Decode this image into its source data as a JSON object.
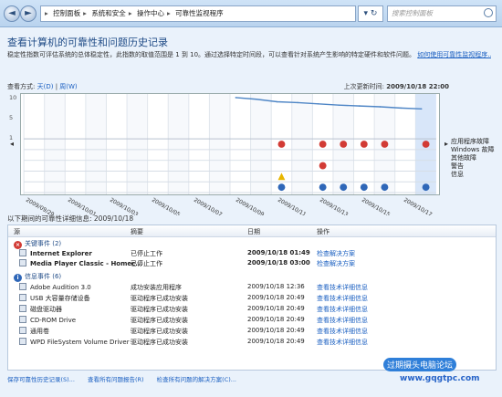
{
  "address": {
    "crumbs": [
      "控制面板",
      "系统和安全",
      "操作中心",
      "可靠性监视程序"
    ],
    "search_placeholder": "搜索控制面板"
  },
  "page": {
    "title": "查看计算机的可靠性和问题历史记录",
    "description": "稳定性指数可评估系统的总体稳定性，此指数的取值范围是 1 到 10。通过选择特定时间段，可以查看针对系统产生影响的特定硬件和软件问题。",
    "description_link": "如何使用可靠性监视程序..."
  },
  "view": {
    "label": "查看方式:",
    "day": "天(D)",
    "sep": "|",
    "week": "周(W)"
  },
  "last_updated": {
    "label": "上次更新时间:",
    "value": "2009/10/18 22:00"
  },
  "chart_data": {
    "type": "line",
    "x": [
      "2009/09/29",
      "2009/10/01",
      "2009/10/03",
      "2009/10/05",
      "2009/10/07",
      "2009/10/09",
      "2009/10/11",
      "2009/10/13",
      "2009/10/15",
      "2009/10/17"
    ],
    "y_ticks": [
      "10",
      "5",
      "1"
    ],
    "ylim": [
      1,
      10
    ],
    "series": [
      {
        "points": [
          [
            "2009/10/09",
            10
          ],
          [
            "2009/10/10",
            9.6
          ],
          [
            "2009/10/11",
            9.0
          ],
          [
            "2009/10/12",
            8.8
          ],
          [
            "2009/10/13",
            8.5
          ],
          [
            "2009/10/14",
            8.2
          ],
          [
            "2009/10/15",
            8.0
          ],
          [
            "2009/10/16",
            7.8
          ],
          [
            "2009/10/17",
            7.5
          ],
          [
            "2009/10/18",
            7.3
          ]
        ]
      }
    ],
    "row_labels": [
      "应用程序故障",
      "Windows 故障",
      "其他故障",
      "警告",
      "信息"
    ]
  },
  "details": {
    "label": "以下期间的可靠性详细信息: 2009/10/18",
    "columns": [
      "源",
      "摘要",
      "日期",
      "操作"
    ],
    "groups": [
      {
        "title": "关键事件 (2)",
        "rows": [
          {
            "source": "Internet Explorer",
            "summary": "已停止工作",
            "date": "2009/10/18 01:49",
            "action": "检查解决方案"
          },
          {
            "source": "Media Player Classic - Homec...",
            "summary": "已停止工作",
            "date": "2009/10/18 03:00",
            "action": "检查解决方案"
          }
        ]
      },
      {
        "title": "信息事件 (6)",
        "rows": [
          {
            "source": "Adobe Audition 3.0",
            "summary": "成功安装应用程序",
            "date": "2009/10/18 12:36",
            "action": "查看技术详细信息"
          },
          {
            "source": "USB 大容量存储设备",
            "summary": "驱动程序已成功安装",
            "date": "2009/10/18 20:49",
            "action": "查看技术详细信息"
          },
          {
            "source": "磁盘驱动器",
            "summary": "驱动程序已成功安装",
            "date": "2009/10/18 20:49",
            "action": "查看技术详细信息"
          },
          {
            "source": "CD-ROM Drive",
            "summary": "驱动程序已成功安装",
            "date": "2009/10/18 20:49",
            "action": "查看技术详细信息"
          },
          {
            "source": "通用卷",
            "summary": "驱动程序已成功安装",
            "date": "2009/10/18 20:49",
            "action": "查看技术详细信息"
          },
          {
            "source": "WPD FileSystem Volume Driver",
            "summary": "驱动程序已成功安装",
            "date": "2009/10/18 20:49",
            "action": "查看技术详细信息"
          }
        ]
      }
    ]
  },
  "footer": {
    "save": "保存可靠性历史记录(S)...",
    "view_all": "查看所有问题报告(R)",
    "check_all": "检查所有问题的解决方案(C)..."
  },
  "watermark": {
    "brand": "过期摄头电脑论坛",
    "url": "www.gqgtpc.com"
  }
}
